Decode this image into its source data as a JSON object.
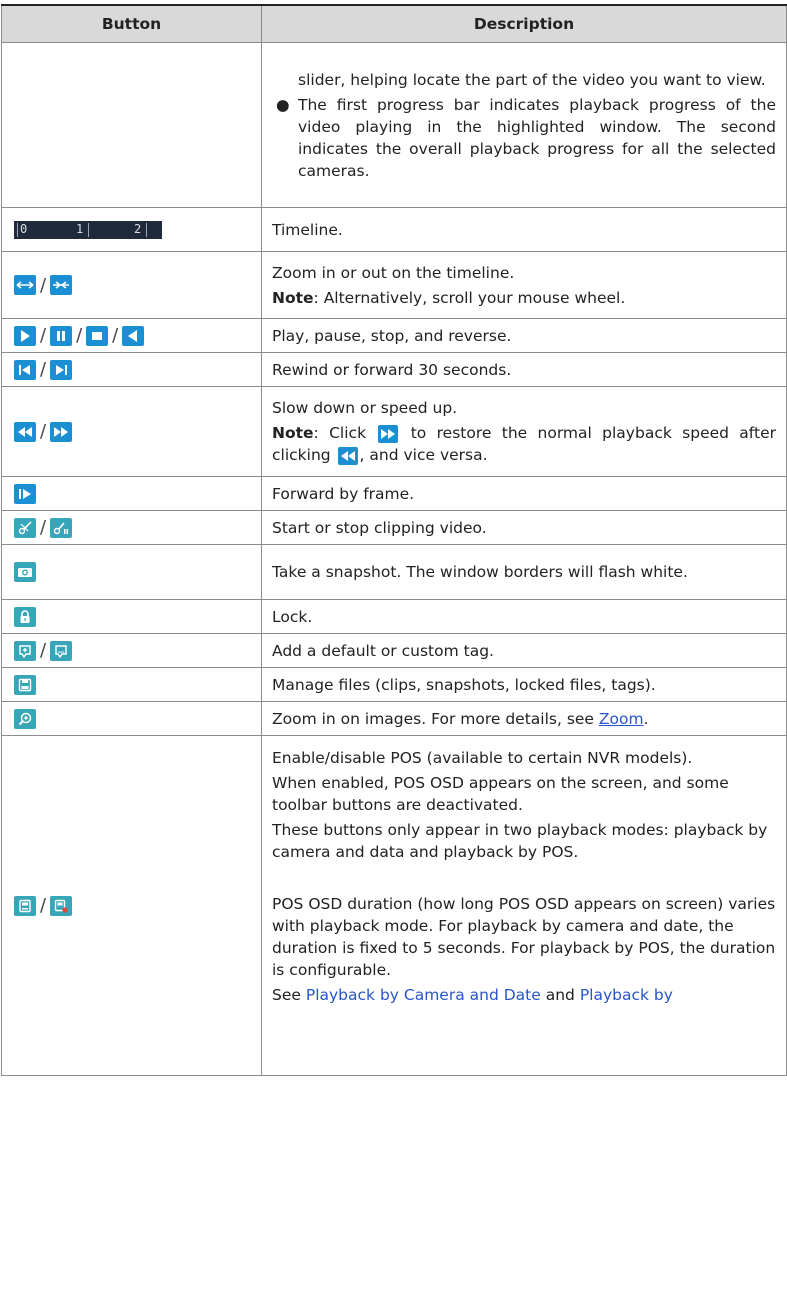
{
  "table": {
    "headers": {
      "button": "Button",
      "description": "Description"
    },
    "rows": [
      {
        "icons": [],
        "continued_text": "slider, helping locate the part of the video you want to view.",
        "bullet": "The first progress bar indicates playback progress of the video playing in the highlighted window. The second indicates the overall playback progress for all the selected cameras."
      },
      {
        "icons": [
          "timeline-image"
        ],
        "timeline_labels": [
          "0",
          "1",
          "2"
        ],
        "text": "Timeline."
      },
      {
        "icons": [
          "zoom-in-timeline-icon",
          "zoom-out-timeline-icon"
        ],
        "text": "Zoom in or out on the timeline.",
        "note_label": "Note",
        "note_text": ": Alternatively, scroll your mouse wheel."
      },
      {
        "icons": [
          "play-icon",
          "pause-icon",
          "stop-icon",
          "reverse-icon"
        ],
        "text": "Play, pause, stop, and reverse."
      },
      {
        "icons": [
          "rewind-30s-icon",
          "forward-30s-icon"
        ],
        "text": "Rewind or forward 30 seconds."
      },
      {
        "icons": [
          "slow-down-icon",
          "speed-up-icon"
        ],
        "text": "Slow down or speed up.",
        "note_label": "Note",
        "note_part1": ": Click",
        "note_part2": "to restore the normal playback speed after clicking",
        "note_part3": ", and vice versa."
      },
      {
        "icons": [
          "frame-forward-icon"
        ],
        "text": "Forward by frame."
      },
      {
        "icons": [
          "start-clip-icon",
          "stop-clip-icon"
        ],
        "text": "Start or stop clipping video."
      },
      {
        "icons": [
          "snapshot-icon"
        ],
        "text": "Take a snapshot. The window borders will flash white."
      },
      {
        "icons": [
          "lock-icon"
        ],
        "text": "Lock."
      },
      {
        "icons": [
          "default-tag-icon",
          "custom-tag-icon"
        ],
        "text": "Add a default or custom tag."
      },
      {
        "icons": [
          "manage-files-icon"
        ],
        "text": "Manage files (clips, snapshots, locked files, tags)."
      },
      {
        "icons": [
          "digital-zoom-icon"
        ],
        "text_before": "Zoom in on images. For more details, see",
        "link": "Zoom",
        "text_after": "."
      },
      {
        "icons": [
          "pos-enable-icon",
          "pos-disable-icon"
        ],
        "p1": "Enable/disable POS (available to certain NVR models).",
        "p2": "When enabled, POS OSD appears on the screen, and some toolbar buttons are deactivated.",
        "p3": "These buttons only appear in two playback modes: playback by camera and data and playback by POS.",
        "p4": "POS OSD duration (how long POS OSD appears on screen) varies with playback mode. For playback by camera and date, the duration is fixed to 5 seconds. For playback by POS, the duration is configurable.",
        "p5_before": "See",
        "p5_link1": "Playback by Camera and Date",
        "p5_mid": "and",
        "p5_link2": "Playback by"
      }
    ]
  }
}
